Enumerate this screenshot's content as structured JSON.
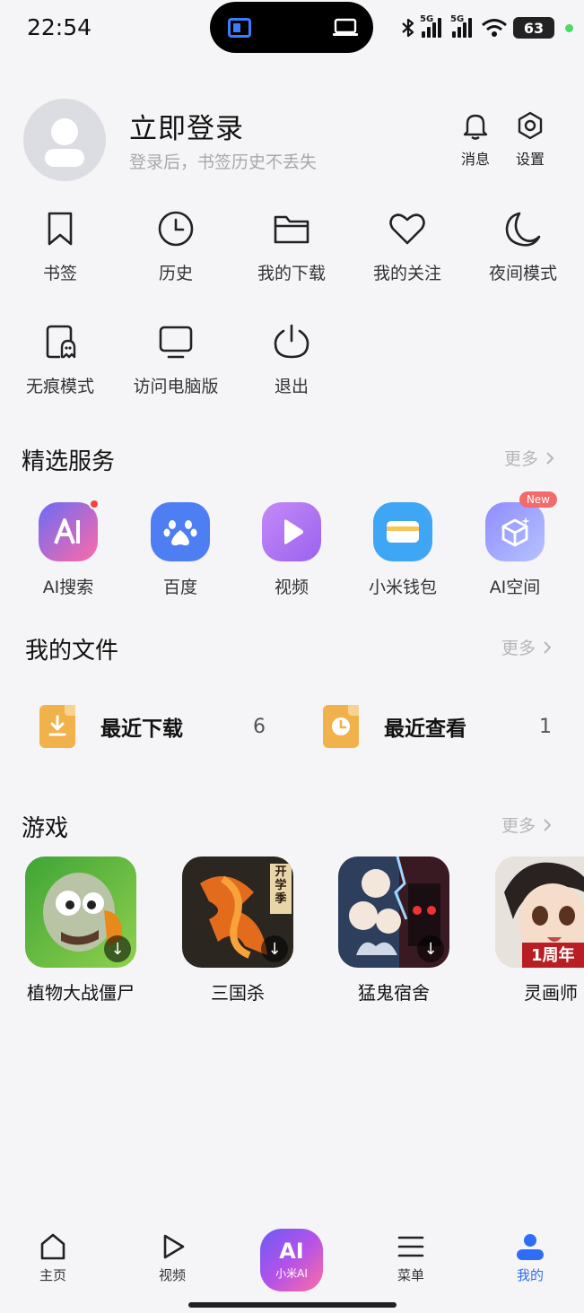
{
  "status": {
    "time": "22:54",
    "net1": "5G",
    "net2": "5G",
    "battery": "63"
  },
  "profile": {
    "title": "立即登录",
    "subtitle": "登录后，书签历史不丢失"
  },
  "top_actions": {
    "messages": "消息",
    "settings": "设置"
  },
  "quick": [
    {
      "label": "书签",
      "icon": "bookmark-icon"
    },
    {
      "label": "历史",
      "icon": "clock-icon"
    },
    {
      "label": "我的下载",
      "icon": "folder-icon"
    },
    {
      "label": "我的关注",
      "icon": "heart-icon"
    },
    {
      "label": "夜间模式",
      "icon": "moon-icon"
    },
    {
      "label": "无痕模式",
      "icon": "ghost-icon"
    },
    {
      "label": "访问电脑版",
      "icon": "monitor-icon"
    },
    {
      "label": "退出",
      "icon": "power-icon"
    }
  ],
  "services": {
    "title": "精选服务",
    "more": "更多",
    "items": [
      {
        "label": "AI搜索",
        "color": "#ff6aa8"
      },
      {
        "label": "百度",
        "color": "#4d7ef2"
      },
      {
        "label": "视频",
        "color": "#b67cf2"
      },
      {
        "label": "小米钱包",
        "color": "#3ea6f5"
      },
      {
        "label": "AI空间",
        "color": "#9aa8ff",
        "badge": "New"
      }
    ]
  },
  "files": {
    "title": "我的文件",
    "more": "更多",
    "items": [
      {
        "label": "最近下载",
        "count": "6"
      },
      {
        "label": "最近查看",
        "count": "1"
      }
    ]
  },
  "games": {
    "title": "游戏",
    "more": "更多",
    "items": [
      {
        "label": "植物大战僵尸"
      },
      {
        "label": "三国杀",
        "art_text": "开学季"
      },
      {
        "label": "猛鬼宿舍"
      },
      {
        "label": "灵画师",
        "art_text": "1周年"
      }
    ]
  },
  "nav": {
    "home": "主页",
    "video": "视频",
    "center": "小米AI",
    "center_glyph": "AI",
    "menu": "菜单",
    "me": "我的"
  },
  "colors": {
    "accent": "#2f6df6",
    "file_icon": "#f1b24b"
  }
}
